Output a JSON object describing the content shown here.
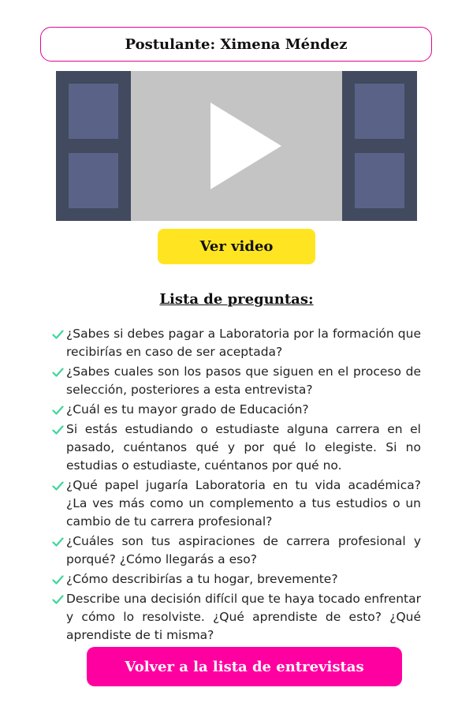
{
  "applicant": {
    "label": "Postulante: Ximena Méndez"
  },
  "video": {
    "play_icon": "play-icon",
    "button_label": "Ver video"
  },
  "questions": {
    "title": "Lista de preguntas:",
    "check_icon": "check-icon",
    "check_color": "#3ed69a",
    "items": [
      "¿Sabes si debes pagar a Laboratoria por la formación que recibirías en caso de ser aceptada?",
      "¿Sabes cuales son los pasos que siguen en el proceso de selección, posteriores a esta entrevista?",
      "¿Cuál es tu mayor grado de Educación?",
      "Si estás estudiando o estudiaste alguna carrera en el pasado, cuéntanos qué y por qué lo elegiste. Si no estudias o estudiaste, cuéntanos por qué no.",
      "¿Qué papel jugaría Laboratoria en tu vida académica? ¿La ves más como un complemento a tus estudios o un cambio de tu carrera profesional?",
      "¿Cuáles son tus aspiraciones de carrera profesional y porqué? ¿Cómo llegarás a eso?",
      "¿Cómo describirías a tu hogar, brevemente?",
      "Describe una decisión difícil que te haya tocado enfrentar y cómo lo resolviste. ¿Qué aprendiste de esto? ¿Qué aprendiste de ti misma?"
    ]
  },
  "footer": {
    "back_label": "Volver a la lista de entrevistas"
  },
  "colors": {
    "accent_pink": "#ff00a0",
    "accent_yellow": "#ffe521",
    "border_pink": "#e0058f"
  }
}
